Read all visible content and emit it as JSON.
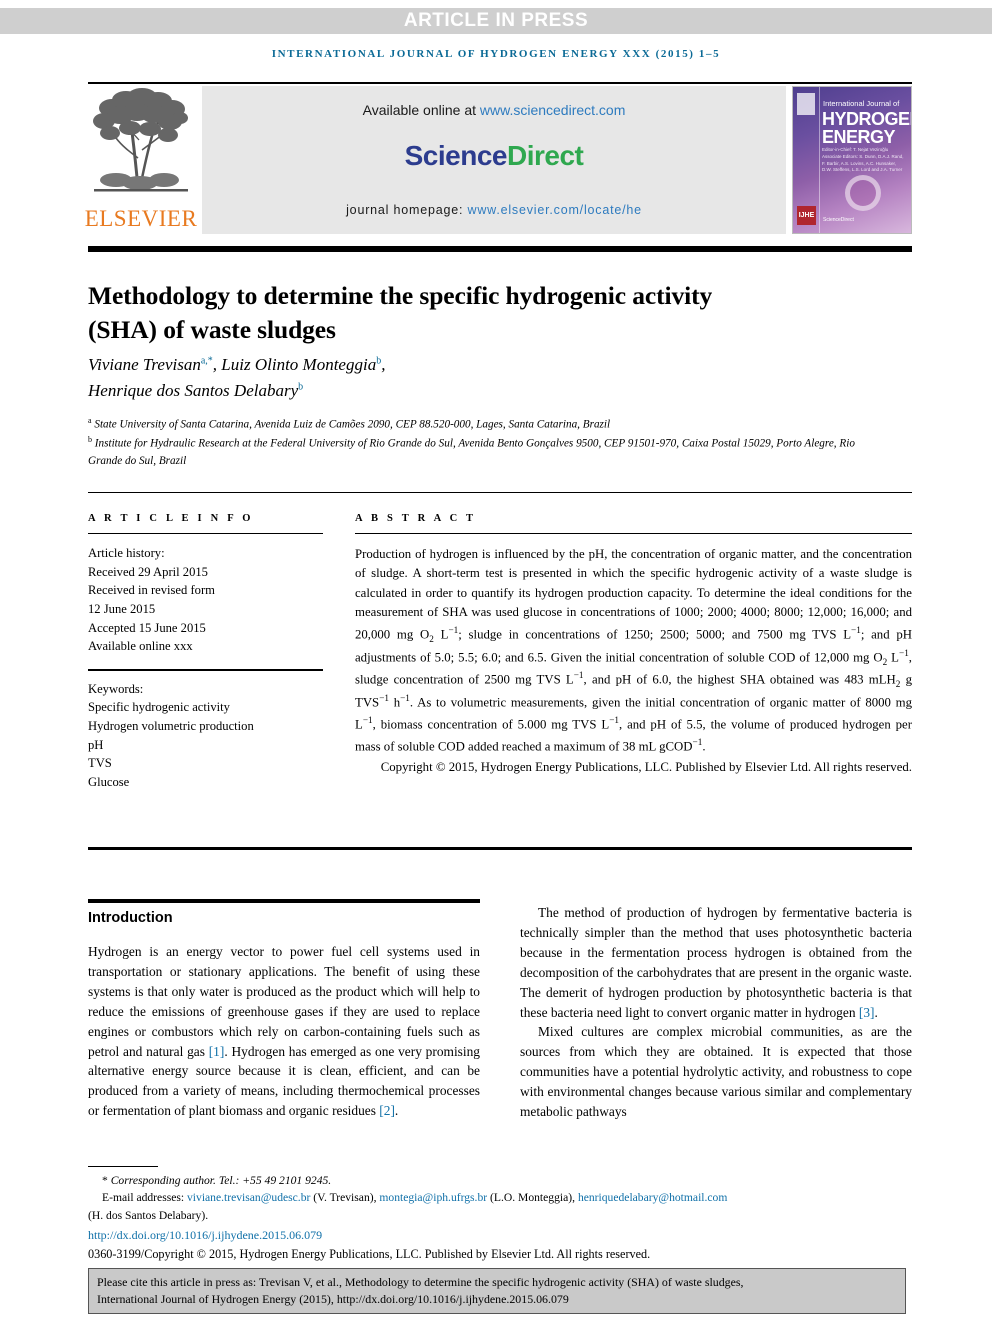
{
  "banner": {
    "text": "ARTICLE IN PRESS"
  },
  "running_head": {
    "text": "INTERNATIONAL JOURNAL OF HYDROGEN ENERGY XXX (2015) 1–5"
  },
  "header": {
    "publisher": "ELSEVIER",
    "available_label": "Available online at ",
    "available_url": "www.sciencedirect.com",
    "brand_part1": "Science",
    "brand_part2": "Direct",
    "homepage_label": "journal homepage: ",
    "homepage_url": "www.elsevier.com/locate/he",
    "cover": {
      "line_small": "International Journal of",
      "line1": "HYDROGEN",
      "line2": "ENERGY",
      "editors": "Editor-in-Chief: T. Nejat Veziroğlu   Associate Editors: S. Dunn, D.A.J. Rand, F. Barbir, A.S. Lovins, A.C. Hunsaker, D.W. Steffens, L.S. Lord and J.A. Turner",
      "badge": "IJHE",
      "sciencedirect": "ScienceDirect"
    }
  },
  "article": {
    "title": "Methodology to determine the specific hydrogenic activity (SHA) of waste sludges",
    "authors_line1_name1": "Viviane Trevisan",
    "authors_line1_sup1": "a,*",
    "authors_line1_name2": "Luiz Olinto Monteggia",
    "authors_line1_sup2": "b",
    "authors_line2_name": "Henrique dos Santos Delabary",
    "authors_line2_sup": "b",
    "affiliation_a_marker": "a",
    "affiliation_a": "State University of Santa Catarina, Avenida Luiz de Camões 2090, CEP 88.520-000, Lages, Santa Catarina, Brazil",
    "affiliation_b_marker": "b",
    "affiliation_b": "Institute for Hydraulic Research at the Federal University of Rio Grande do Sul, Avenida Bento Gonçalves 9500, CEP 91501-970, Caixa Postal 15029, Porto Alegre, Rio Grande do Sul, Brazil"
  },
  "article_info": {
    "heading": "A R T I C L E   I N F O",
    "history_label": "Article history:",
    "history": [
      "Received 29 April 2015",
      "Received in revised form",
      "12 June 2015",
      "Accepted 15 June 2015",
      "Available online xxx"
    ],
    "keywords_label": "Keywords:",
    "keywords": [
      "Specific hydrogenic activity",
      "Hydrogen volumetric production",
      "pH",
      "TVS",
      "Glucose"
    ]
  },
  "abstract": {
    "heading": "A B S T R A C T",
    "paragraph_part1": "Production of hydrogen is influenced by the pH, the concentration of organic matter, and the concentration of sludge. A short-term test is presented in which the specific hydrogenic activity of a waste sludge is calculated in order to quantify its hydrogen production capacity. To determine the ideal conditions for the measurement of SHA was used glucose in concentrations of 1000; 2000; 4000; 8000; 12,000; 16,000; and 20,000 mg O",
    "sub_o2": "2",
    "paragraph_part2": " L",
    "sup_m1_a": "−1",
    "paragraph_part3": "; sludge in concentrations of 1250; 2500; 5000; and 7500 mg TVS L",
    "sup_m1_b": "−1",
    "paragraph_part4": "; and pH adjustments of 5.0; 5.5; 6.0; and 6.5. Given the initial concentration of soluble COD of 12,000 mg O",
    "sub_o2_c": "2",
    "paragraph_part5": " L",
    "sup_m1_c": "−1",
    "paragraph_part6": ", sludge concentration of 2500 mg TVS L",
    "sup_m1_d": "−1",
    "paragraph_part7": ", and pH of 6.0, the highest SHA obtained was 483 mLH",
    "sub_h2": "2",
    "paragraph_part8": " g TVS",
    "sup_m1_e": "−1",
    "paragraph_part9": " h",
    "sup_m1_f": "−1",
    "paragraph_part10": ". As to volumetric measurements, given the initial concentration of organic matter of 8000 mg L",
    "sup_m1_g": "−1",
    "paragraph_part11": ", biomass concentration of 5.000 mg TVS L",
    "sup_m1_h": "−1",
    "paragraph_part12": ", and pH of 5.5, the volume of produced hydrogen per mass of soluble COD added reached a maximum of 38 mL gCOD",
    "sup_m1_i": "−1",
    "paragraph_part13": ".",
    "copyright": "Copyright © 2015, Hydrogen Energy Publications, LLC. Published by Elsevier Ltd. All rights reserved."
  },
  "body": {
    "intro_heading": "Introduction",
    "left_p1_a": "Hydrogen is an energy vector to power fuel cell systems used in transportation or stationary applications. The benefit of using these systems is that only water is produced as the product which will help to reduce the emissions of greenhouse gases if they are used to replace engines or combustors which rely on carbon-containing fuels such as petrol and natural gas ",
    "left_p1_ref1": "[1]",
    "left_p1_b": ". Hydrogen has emerged as one very promising alternative energy source because it is clean, efficient, and can be produced from a variety of means, including thermochemical processes or fermentation of plant biomass and organic residues ",
    "left_p1_ref2": "[2]",
    "left_p1_c": ".",
    "right_p1_a": "The method of production of hydrogen by fermentative bacteria is technically simpler than the method that uses photosynthetic bacteria because in the fermentation process hydrogen is obtained from the decomposition of the carbohydrates that are present in the organic waste. The demerit of hydrogen production by photosynthetic bacteria is that these bacteria need light to convert organic matter in hydrogen ",
    "right_p1_ref": "[3]",
    "right_p1_b": ".",
    "right_p2": "Mixed cultures are complex microbial communities, as are the sources from which they are obtained. It is expected that those communities have a potential hydrolytic activity, and robustness to cope with environmental changes because various similar and complementary metabolic pathways"
  },
  "footnote": {
    "corresponding": "Corresponding author. Tel.: +55 49 2101 9245.",
    "email_label": "E-mail addresses: ",
    "email1": "viviane.trevisan@udesc.br",
    "email1_owner": " (V. Trevisan), ",
    "email2": "montegia@iph.ufrgs.br",
    "email2_owner": " (L.O. Monteggia), ",
    "email3": "henriquedelabary@hotmail.com",
    "email3_owner": "(H. dos Santos Delabary).",
    "doi": "http://dx.doi.org/10.1016/j.ijhydene.2015.06.079",
    "issn": "0360-3199/Copyright © 2015, Hydrogen Energy Publications, LLC. Published by Elsevier Ltd. All rights reserved."
  },
  "cite_box": {
    "line1": "Please cite this article in press as: Trevisan V, et al., Methodology to determine the specific hydrogenic activity (SHA) of waste sludges,",
    "line2": "International Journal of Hydrogen Energy (2015), http://dx.doi.org/10.1016/j.ijhydene.2015.06.079"
  },
  "colors": {
    "banner_bg": "#cfcfcf",
    "running_head": "#0b6a96",
    "link": "#1070a8",
    "sciencedirect_green": "#2fa84f",
    "sciencedirect_blue": "#2c3c8e",
    "elsevier_orange": "#e87a20",
    "cite_box_bg": "#c9c9c9"
  }
}
